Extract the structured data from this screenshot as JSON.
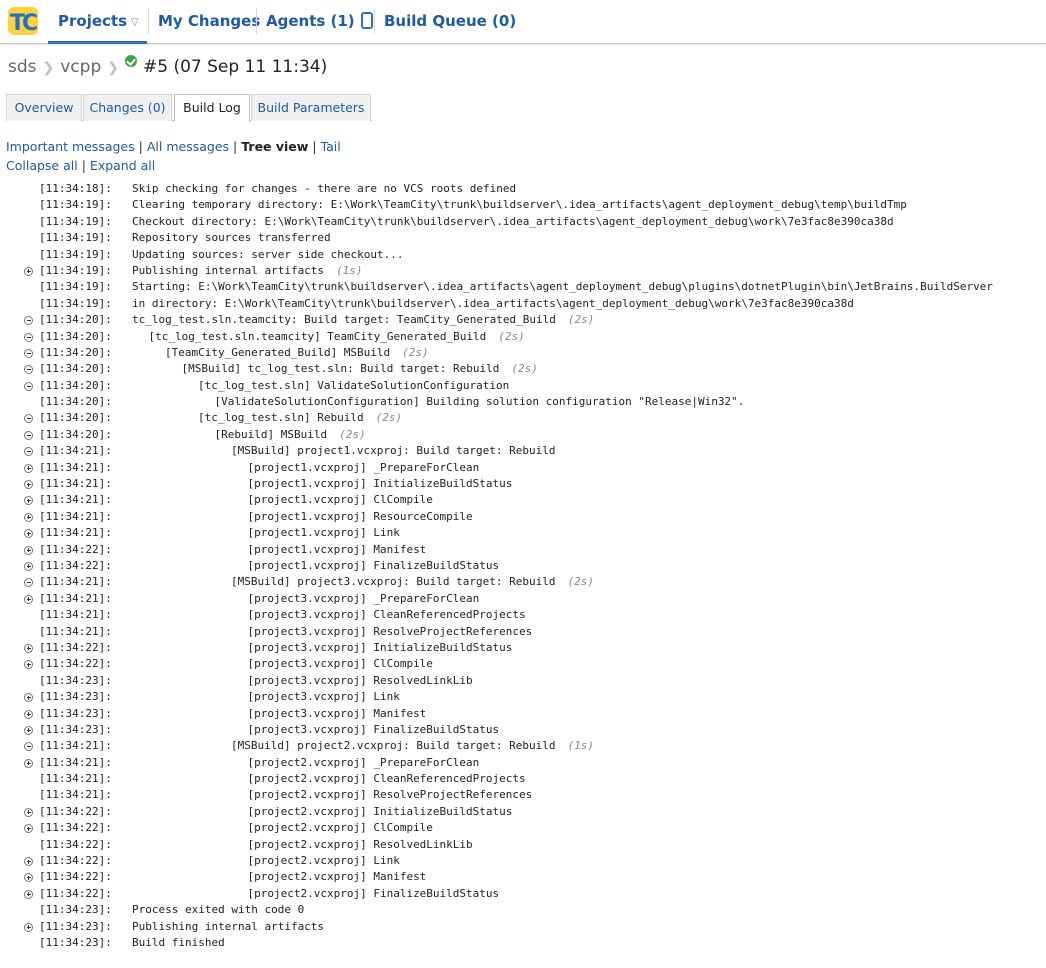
{
  "nav": {
    "projects": "Projects",
    "my_changes": "My Changes",
    "agents": "Agents (1)",
    "build_queue": "Build Queue (0)"
  },
  "breadcrumb": {
    "project": "sds",
    "config": "vcpp",
    "build": "#5 (07 Sep 11 11:34)",
    "status_color": "#3aa63a"
  },
  "tabs": {
    "overview": "Overview",
    "changes": "Changes (0)",
    "build_log": "Build Log",
    "build_parameters": "Build Parameters"
  },
  "view_options": {
    "important": "Important messages",
    "all": "All messages",
    "tree": "Tree view",
    "tail": "Tail",
    "collapse_all": "Collapse all",
    "expand_all": "Expand all"
  },
  "log": [
    {
      "t": "[11:34:18]:",
      "indent": 0,
      "toggle": "",
      "text": "Skip checking for changes - there are no VCS roots defined",
      "dur": ""
    },
    {
      "t": "[11:34:19]:",
      "indent": 0,
      "toggle": "",
      "text": "Clearing temporary directory: E:\\Work\\TeamCity\\trunk\\buildserver\\.idea_artifacts\\agent_deployment_debug\\temp\\buildTmp",
      "dur": ""
    },
    {
      "t": "[11:34:19]:",
      "indent": 0,
      "toggle": "",
      "text": "Checkout directory: E:\\Work\\TeamCity\\trunk\\buildserver\\.idea_artifacts\\agent_deployment_debug\\work\\7e3fac8e390ca38d",
      "dur": ""
    },
    {
      "t": "[11:34:19]:",
      "indent": 0,
      "toggle": "",
      "text": "Repository sources transferred",
      "dur": ""
    },
    {
      "t": "[11:34:19]:",
      "indent": 0,
      "toggle": "",
      "text": "Updating sources: server side checkout...",
      "dur": ""
    },
    {
      "t": "[11:34:19]:",
      "indent": 0,
      "toggle": "plus",
      "text": "Publishing internal artifacts",
      "dur": "(1s)"
    },
    {
      "t": "[11:34:19]:",
      "indent": 0,
      "toggle": "",
      "text": "Starting: E:\\Work\\TeamCity\\trunk\\buildserver\\.idea_artifacts\\agent_deployment_debug\\plugins\\dotnetPlugin\\bin\\JetBrains.BuildServer",
      "dur": ""
    },
    {
      "t": "[11:34:19]:",
      "indent": 0,
      "toggle": "",
      "text": "in directory: E:\\Work\\TeamCity\\trunk\\buildserver\\.idea_artifacts\\agent_deployment_debug\\work\\7e3fac8e390ca38d",
      "dur": ""
    },
    {
      "t": "[11:34:20]:",
      "indent": 0,
      "toggle": "minus",
      "text": "tc_log_test.sln.teamcity: Build target: TeamCity_Generated_Build",
      "dur": "(2s)"
    },
    {
      "t": "[11:34:20]:",
      "indent": 1,
      "toggle": "minus",
      "text": "[tc_log_test.sln.teamcity] TeamCity_Generated_Build",
      "dur": "(2s)"
    },
    {
      "t": "[11:34:20]:",
      "indent": 2,
      "toggle": "minus",
      "text": "[TeamCity_Generated_Build] MSBuild",
      "dur": "(2s)"
    },
    {
      "t": "[11:34:20]:",
      "indent": 3,
      "toggle": "minus",
      "text": "[MSBuild] tc_log_test.sln: Build target: Rebuild",
      "dur": "(2s)"
    },
    {
      "t": "[11:34:20]:",
      "indent": 4,
      "toggle": "minus",
      "text": "[tc_log_test.sln] ValidateSolutionConfiguration",
      "dur": ""
    },
    {
      "t": "[11:34:20]:",
      "indent": 5,
      "toggle": "",
      "text": "[ValidateSolutionConfiguration] Building solution configuration \"Release|Win32\".",
      "dur": ""
    },
    {
      "t": "[11:34:20]:",
      "indent": 4,
      "toggle": "minus",
      "text": "[tc_log_test.sln] Rebuild",
      "dur": "(2s)"
    },
    {
      "t": "[11:34:20]:",
      "indent": 5,
      "toggle": "minus",
      "text": "[Rebuild] MSBuild",
      "dur": "(2s)"
    },
    {
      "t": "[11:34:21]:",
      "indent": 6,
      "toggle": "minus",
      "text": "[MSBuild] project1.vcxproj: Build target: Rebuild",
      "dur": ""
    },
    {
      "t": "[11:34:21]:",
      "indent": 7,
      "toggle": "plus",
      "text": "[project1.vcxproj] _PrepareForClean",
      "dur": ""
    },
    {
      "t": "[11:34:21]:",
      "indent": 7,
      "toggle": "plus",
      "text": "[project1.vcxproj] InitializeBuildStatus",
      "dur": ""
    },
    {
      "t": "[11:34:21]:",
      "indent": 7,
      "toggle": "plus",
      "text": "[project1.vcxproj] ClCompile",
      "dur": ""
    },
    {
      "t": "[11:34:21]:",
      "indent": 7,
      "toggle": "plus",
      "text": "[project1.vcxproj] ResourceCompile",
      "dur": ""
    },
    {
      "t": "[11:34:21]:",
      "indent": 7,
      "toggle": "plus",
      "text": "[project1.vcxproj] Link",
      "dur": ""
    },
    {
      "t": "[11:34:22]:",
      "indent": 7,
      "toggle": "plus",
      "text": "[project1.vcxproj] Manifest",
      "dur": ""
    },
    {
      "t": "[11:34:22]:",
      "indent": 7,
      "toggle": "plus",
      "text": "[project1.vcxproj] FinalizeBuildStatus",
      "dur": ""
    },
    {
      "t": "[11:34:21]:",
      "indent": 6,
      "toggle": "minus",
      "text": "[MSBuild] project3.vcxproj: Build target: Rebuild",
      "dur": "(2s)"
    },
    {
      "t": "[11:34:21]:",
      "indent": 7,
      "toggle": "plus",
      "text": "[project3.vcxproj] _PrepareForClean",
      "dur": ""
    },
    {
      "t": "[11:34:21]:",
      "indent": 7,
      "toggle": "",
      "text": "[project3.vcxproj] CleanReferencedProjects",
      "dur": ""
    },
    {
      "t": "[11:34:21]:",
      "indent": 7,
      "toggle": "",
      "text": "[project3.vcxproj] ResolveProjectReferences",
      "dur": ""
    },
    {
      "t": "[11:34:22]:",
      "indent": 7,
      "toggle": "plus",
      "text": "[project3.vcxproj] InitializeBuildStatus",
      "dur": ""
    },
    {
      "t": "[11:34:22]:",
      "indent": 7,
      "toggle": "plus",
      "text": "[project3.vcxproj] ClCompile",
      "dur": ""
    },
    {
      "t": "[11:34:23]:",
      "indent": 7,
      "toggle": "",
      "text": "[project3.vcxproj] ResolvedLinkLib",
      "dur": ""
    },
    {
      "t": "[11:34:23]:",
      "indent": 7,
      "toggle": "plus",
      "text": "[project3.vcxproj] Link",
      "dur": ""
    },
    {
      "t": "[11:34:23]:",
      "indent": 7,
      "toggle": "plus",
      "text": "[project3.vcxproj] Manifest",
      "dur": ""
    },
    {
      "t": "[11:34:23]:",
      "indent": 7,
      "toggle": "plus",
      "text": "[project3.vcxproj] FinalizeBuildStatus",
      "dur": ""
    },
    {
      "t": "[11:34:21]:",
      "indent": 6,
      "toggle": "minus",
      "text": "[MSBuild] project2.vcxproj: Build target: Rebuild",
      "dur": "(1s)"
    },
    {
      "t": "[11:34:21]:",
      "indent": 7,
      "toggle": "plus",
      "text": "[project2.vcxproj] _PrepareForClean",
      "dur": ""
    },
    {
      "t": "[11:34:21]:",
      "indent": 7,
      "toggle": "",
      "text": "[project2.vcxproj] CleanReferencedProjects",
      "dur": ""
    },
    {
      "t": "[11:34:21]:",
      "indent": 7,
      "toggle": "",
      "text": "[project2.vcxproj] ResolveProjectReferences",
      "dur": ""
    },
    {
      "t": "[11:34:22]:",
      "indent": 7,
      "toggle": "plus",
      "text": "[project2.vcxproj] InitializeBuildStatus",
      "dur": ""
    },
    {
      "t": "[11:34:22]:",
      "indent": 7,
      "toggle": "plus",
      "text": "[project2.vcxproj] ClCompile",
      "dur": ""
    },
    {
      "t": "[11:34:22]:",
      "indent": 7,
      "toggle": "",
      "text": "[project2.vcxproj] ResolvedLinkLib",
      "dur": ""
    },
    {
      "t": "[11:34:22]:",
      "indent": 7,
      "toggle": "plus",
      "text": "[project2.vcxproj] Link",
      "dur": ""
    },
    {
      "t": "[11:34:22]:",
      "indent": 7,
      "toggle": "plus",
      "text": "[project2.vcxproj] Manifest",
      "dur": ""
    },
    {
      "t": "[11:34:22]:",
      "indent": 7,
      "toggle": "plus",
      "text": "[project2.vcxproj] FinalizeBuildStatus",
      "dur": ""
    },
    {
      "t": "[11:34:23]:",
      "indent": 0,
      "toggle": "",
      "text": "Process exited with code 0",
      "dur": ""
    },
    {
      "t": "[11:34:23]:",
      "indent": 0,
      "toggle": "plus",
      "text": "Publishing internal artifacts",
      "dur": ""
    },
    {
      "t": "[11:34:23]:",
      "indent": 0,
      "toggle": "",
      "text": "Build finished",
      "dur": ""
    }
  ]
}
